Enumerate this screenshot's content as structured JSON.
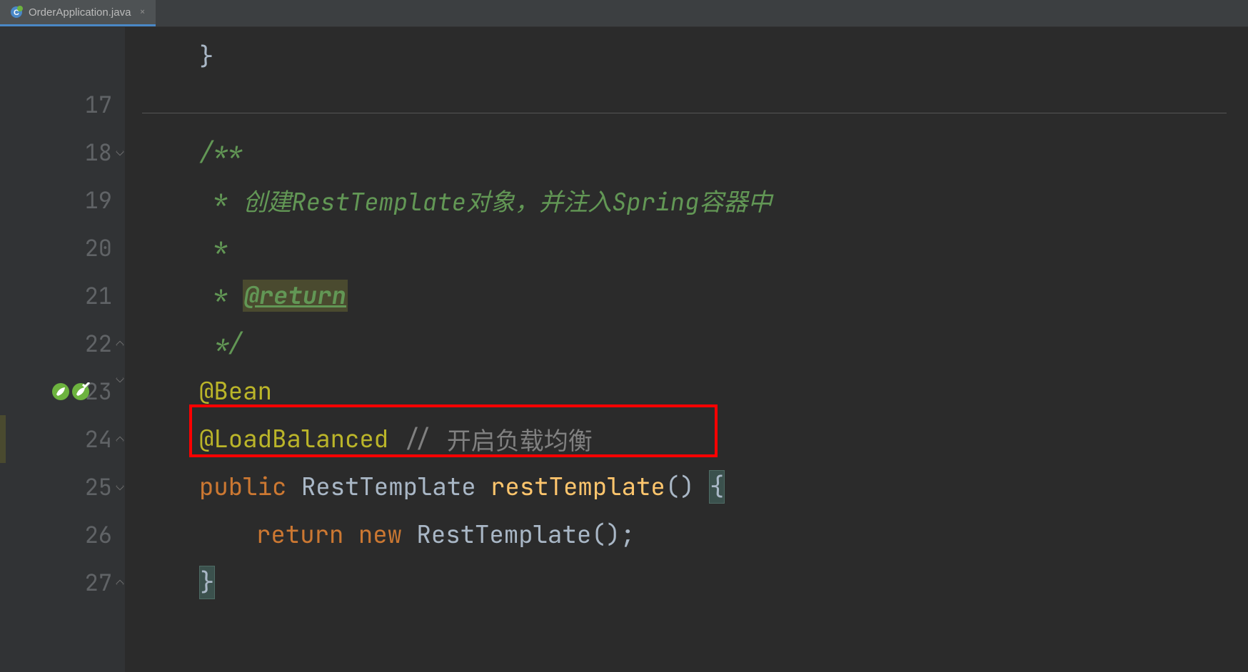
{
  "tab": {
    "filename": "OrderApplication.java",
    "close_glyph": "×"
  },
  "lines": {
    "l16": {
      "num": ""
    },
    "l17": {
      "num": "17"
    },
    "l18": {
      "num": "18",
      "text": "/**"
    },
    "l19": {
      "num": "19",
      "star": " * ",
      "comment": "创建RestTemplate对象，并注入Spring容器中"
    },
    "l20": {
      "num": "20",
      "star": " *"
    },
    "l21": {
      "num": "21",
      "star": " * ",
      "tag": "@return"
    },
    "l22": {
      "num": "22",
      "text": " */"
    },
    "l23": {
      "num": "23",
      "annotation": "@Bean"
    },
    "l24": {
      "num": "24",
      "annotation": "@LoadBalanced",
      "comment_slashes": " // ",
      "comment_text": "开启负载均衡"
    },
    "l25": {
      "num": "25",
      "kw_public": "public ",
      "type": "RestTemplate ",
      "method": "restTemplate",
      "parens": "() ",
      "brace": "{"
    },
    "l26": {
      "num": "26",
      "kw_return": "return ",
      "kw_new": "new ",
      "ctor": "RestTemplate",
      "tail": "();"
    },
    "l27": {
      "num": "27",
      "brace": "}"
    }
  }
}
